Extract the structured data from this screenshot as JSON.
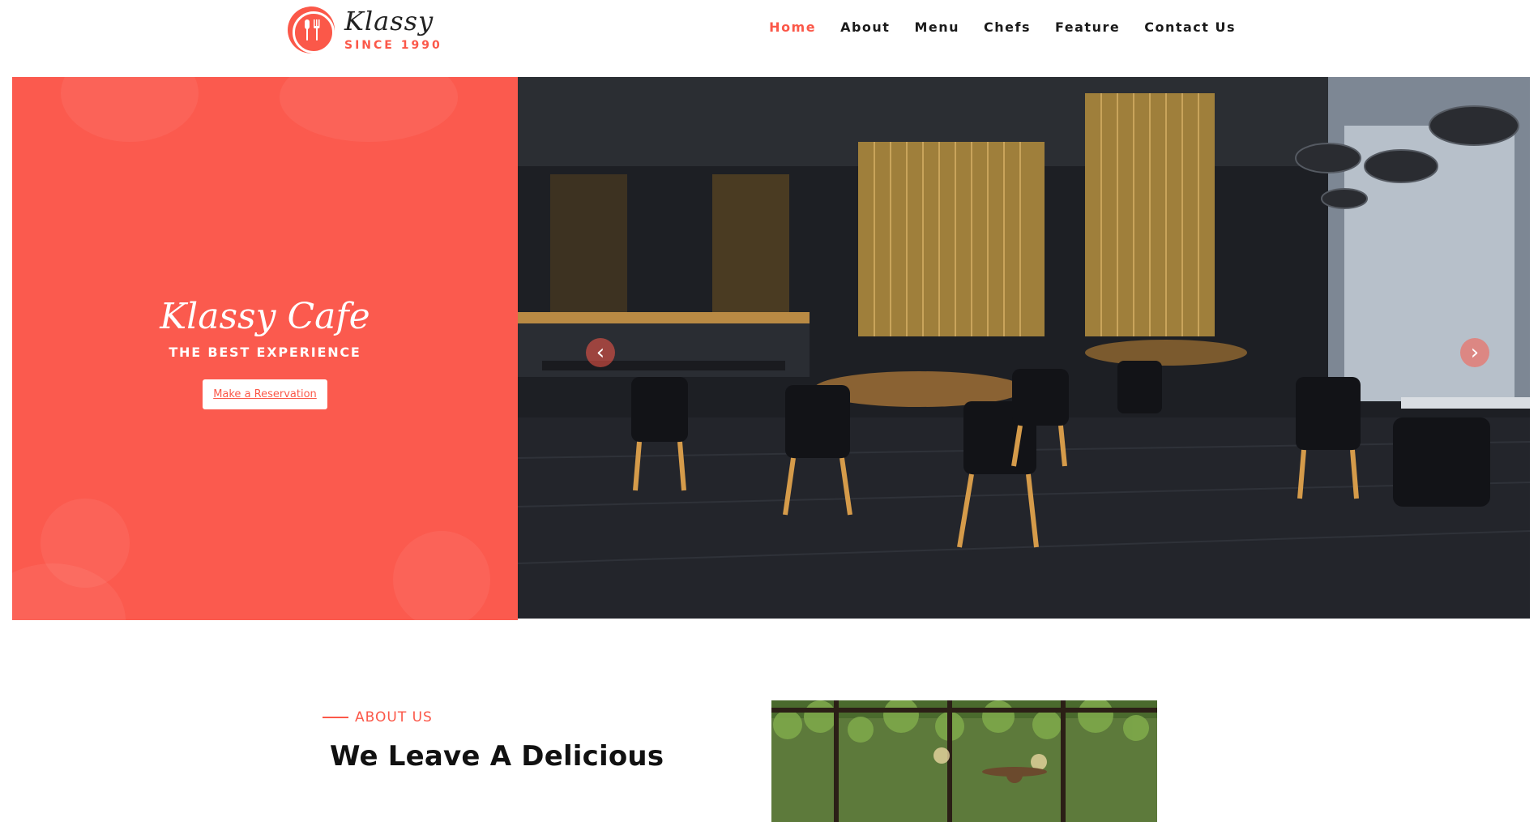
{
  "brand": {
    "name": "Klassy",
    "since": "SINCE 1990",
    "accent": "#fb5849"
  },
  "nav": {
    "items": [
      {
        "label": "Home",
        "active": true
      },
      {
        "label": "About",
        "active": false
      },
      {
        "label": "Menu",
        "active": false
      },
      {
        "label": "Chefs",
        "active": false
      },
      {
        "label": "Feature",
        "active": false
      },
      {
        "label": "Contact Us",
        "active": false
      }
    ]
  },
  "hero": {
    "title": "Klassy Cafe",
    "subtitle": "THE BEST EXPERIENCE",
    "cta_label": "Make a Reservation",
    "promo_color": "#fb5a4e",
    "slider": {
      "prev_icon": "chevron-left-icon",
      "next_icon": "chevron-right-icon"
    }
  },
  "about": {
    "kicker": "ABOUT US",
    "heading": "We Leave A Delicious"
  }
}
